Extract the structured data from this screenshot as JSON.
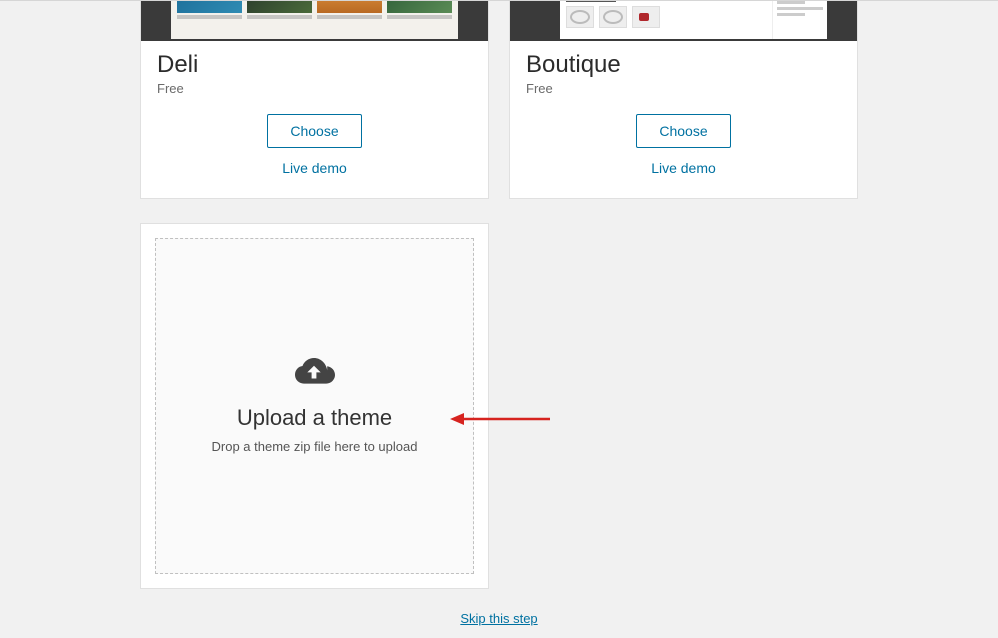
{
  "themes": [
    {
      "title": "Deli",
      "price": "Free",
      "choose": "Choose",
      "demo": "Live demo"
    },
    {
      "title": "Boutique",
      "price": "Free",
      "choose": "Choose",
      "demo": "Live demo"
    }
  ],
  "upload": {
    "title": "Upload a theme",
    "subtitle": "Drop a theme zip file here to upload"
  },
  "skip_label": "Skip this step"
}
